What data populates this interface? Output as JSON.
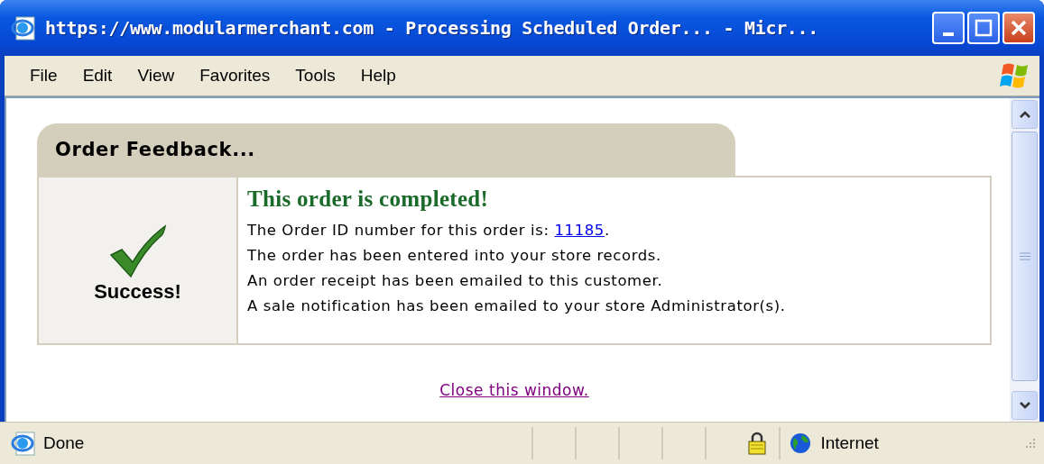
{
  "window": {
    "title": "https://www.modularmerchant.com - Processing Scheduled Order... - Micr..."
  },
  "menu": [
    "File",
    "Edit",
    "View",
    "Favorites",
    "Tools",
    "Help"
  ],
  "panel": {
    "title": "Order Feedback...",
    "status_label": "Success!",
    "heading": "This order is completed!",
    "order_line": {
      "prefix": "The Order ID number for this order is: ",
      "link": "11185",
      "suffix": "."
    },
    "lines": [
      "The order has been entered into your store records.",
      "An order receipt has been emailed to this customer.",
      "A sale notification has been emailed to your store Administrator(s)."
    ]
  },
  "close_link": "Close this window.",
  "status_bar": {
    "text": "Done",
    "zone": "Internet"
  }
}
